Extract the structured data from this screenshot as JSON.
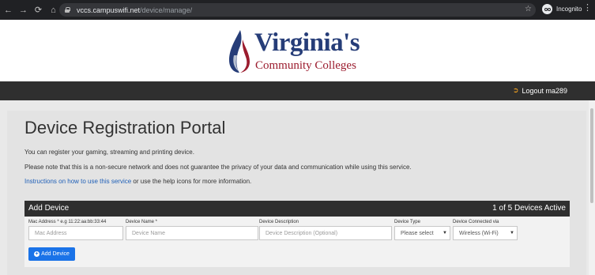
{
  "browser": {
    "url_host": "vccs.campuswifi.net",
    "url_path": "/device/manage/",
    "profile_label": "Incognito"
  },
  "header": {
    "logo_word": "Virginia's",
    "logo_sub": "Community Colleges"
  },
  "nav": {
    "logout_label": "Logout ma289"
  },
  "page": {
    "title": "Device Registration Portal",
    "intro": "You can register your gaming, streaming and printing device.",
    "note": "Please note that this is a non-secure network and does not guarantee the privacy of your data and communication while using this service.",
    "link_text": "Instructions on how to use this service",
    "help_text": " or use the help icons for more information."
  },
  "device_section": {
    "title": "Add Device",
    "count": "1 of 5 Devices Active",
    "fields": {
      "mac_label": "Mac Address * e.g 11:22:aa:bb:33:44",
      "mac_placeholder": "Mac Address",
      "name_label": "Device Name *",
      "name_placeholder": "Device Name",
      "desc_label": "Device Description",
      "desc_placeholder": "Device Description (Optional)",
      "type_label": "Device Type",
      "type_value": "Please select",
      "conn_label": "Device Connected via",
      "conn_value": "Wireless (Wi-Fi)"
    },
    "add_button": "Add Device"
  }
}
